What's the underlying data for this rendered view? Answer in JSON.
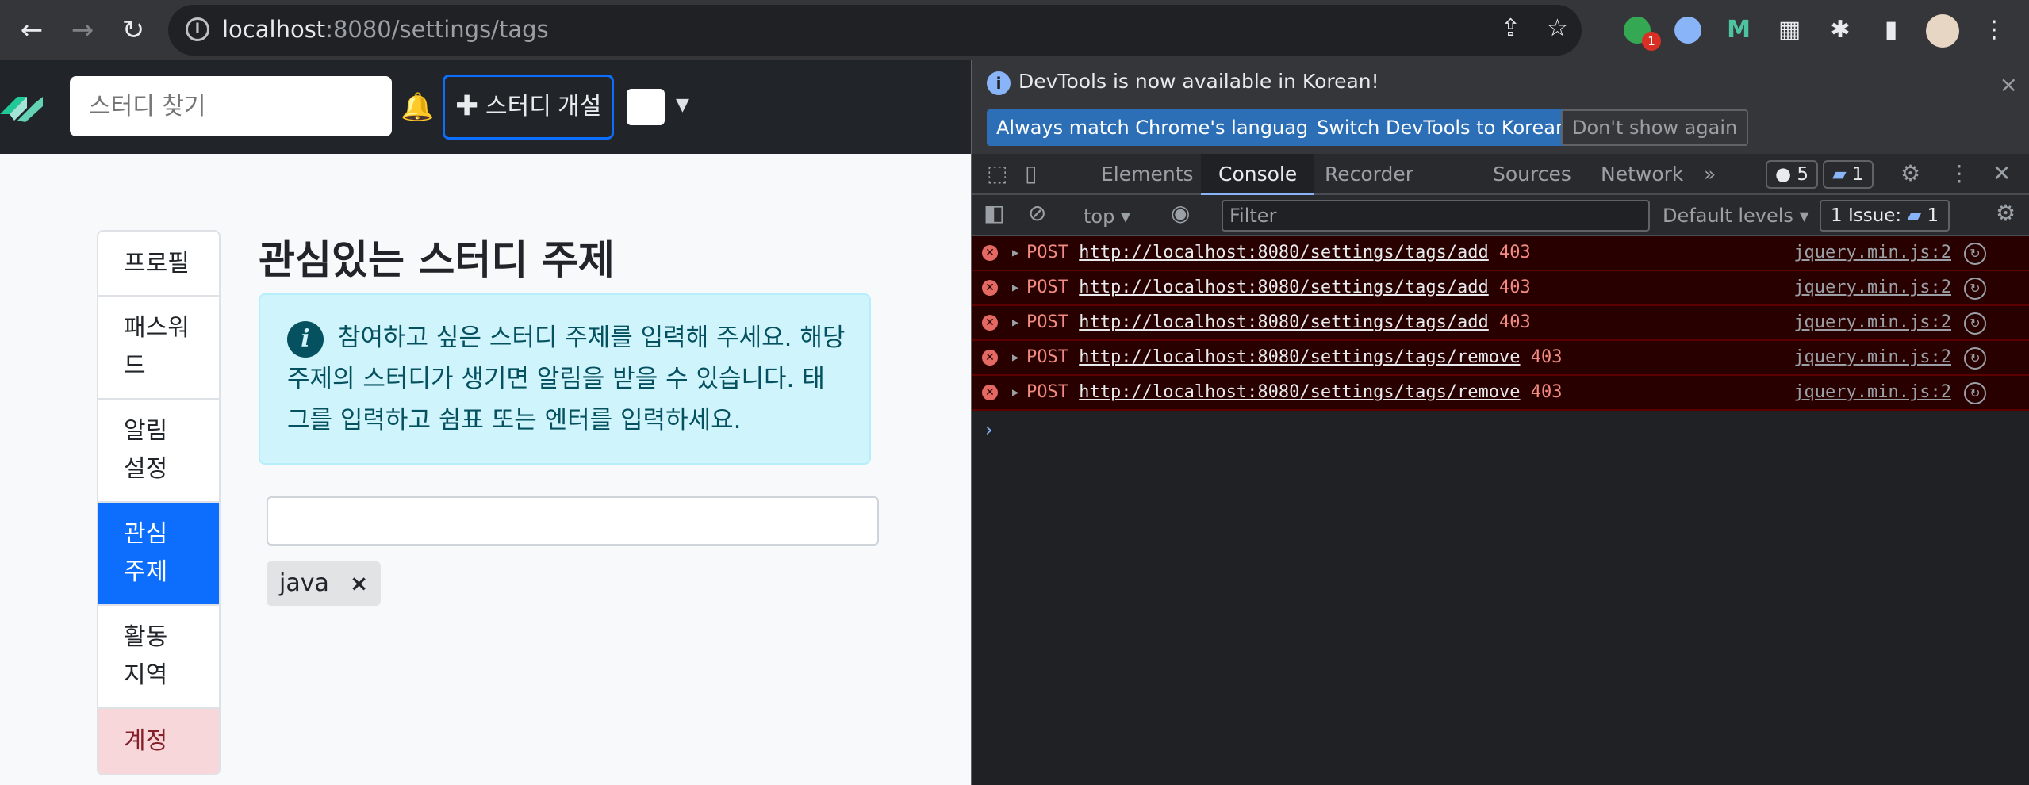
{
  "browser": {
    "url_host": "localhost",
    "url_rest": ":8080/settings/tags",
    "extension_badge": "1"
  },
  "header": {
    "search_placeholder": "스터디 찾기",
    "open_study_label": "스터디 개설",
    "plus_glyph": "✚"
  },
  "settings_menu": {
    "items": [
      {
        "label": "프로필"
      },
      {
        "label": "패스워드"
      },
      {
        "label": "알림 설정"
      },
      {
        "label": "관심 주제"
      },
      {
        "label": "활동 지역"
      },
      {
        "label": "계정"
      }
    ]
  },
  "main": {
    "title": "관심있는 스터디 주제",
    "alert_text": "참여하고 싶은 스터디 주제를 입력해 주세요. 해당 주제의 스터디가 생기면 알림을 받을 수 있습니다. 태그를 입력하고 쉼표 또는 엔터를 입력하세요.",
    "tag_input_value": "",
    "tags": [
      {
        "label": "java",
        "remove": "×"
      }
    ]
  },
  "devtools": {
    "info_message": "DevTools is now available in Korean!",
    "btn_match": "Always match Chrome's language",
    "btn_switch": "Switch DevTools to Korean",
    "btn_dont_show": "Don't show again",
    "tabs": [
      "Elements",
      "Console",
      "Recorder",
      "Sources",
      "Network"
    ],
    "active_tab": "Console",
    "more_tabs": "»",
    "error_count": "5",
    "issue_count": "1",
    "context": "top",
    "filter_placeholder": "Filter",
    "levels": "Default levels",
    "issues_label": "1 Issue:",
    "issues_count": "1",
    "prompt": "›",
    "log": [
      {
        "method": "POST",
        "url": "http://localhost:8080/settings/tags/add",
        "status": "403",
        "source": "jquery.min.js:2"
      },
      {
        "method": "POST",
        "url": "http://localhost:8080/settings/tags/add",
        "status": "403",
        "source": "jquery.min.js:2"
      },
      {
        "method": "POST",
        "url": "http://localhost:8080/settings/tags/add",
        "status": "403",
        "source": "jquery.min.js:2"
      },
      {
        "method": "POST",
        "url": "http://localhost:8080/settings/tags/remove",
        "status": "403",
        "source": "jquery.min.js:2"
      },
      {
        "method": "POST",
        "url": "http://localhost:8080/settings/tags/remove",
        "status": "403",
        "source": "jquery.min.js:2"
      }
    ]
  },
  "colors": {
    "primary": "#0d6efd",
    "alert_bg": "#cff4fc",
    "error_row_bg": "#290000",
    "error_text": "#f28b82"
  }
}
